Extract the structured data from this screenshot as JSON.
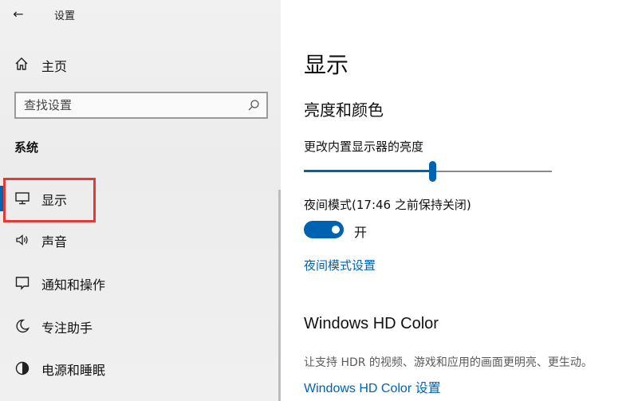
{
  "window": {
    "title": "设置",
    "back_glyph": "←"
  },
  "sidebar": {
    "home_label": "主页",
    "search_placeholder": "查找设置",
    "section_title": "系统",
    "items": [
      {
        "label": "显示",
        "icon": "monitor-icon",
        "selected": true
      },
      {
        "label": "声音",
        "icon": "speaker-icon",
        "selected": false
      },
      {
        "label": "通知和操作",
        "icon": "notification-icon",
        "selected": false
      },
      {
        "label": "专注助手",
        "icon": "moon-icon",
        "selected": false
      },
      {
        "label": "电源和睡眠",
        "icon": "power-icon",
        "selected": false
      }
    ]
  },
  "main": {
    "title": "显示",
    "brightness_section": "亮度和颜色",
    "brightness_label": "更改内置显示器的亮度",
    "brightness_value": 0.52,
    "night_light_label": "夜间模式(17:46 之前保持关闭)",
    "night_light_toggle_state": "开",
    "night_light_on": true,
    "night_light_link": "夜间模式设置",
    "hd_color_title": "Windows HD Color",
    "hd_color_desc": "让支持 HDR 的视频、游戏和应用的画面更明亮、更生动。",
    "hd_color_link": "Windows HD Color 设置"
  },
  "colors": {
    "accent": "#0063b1",
    "highlight_box": "#e53935"
  }
}
